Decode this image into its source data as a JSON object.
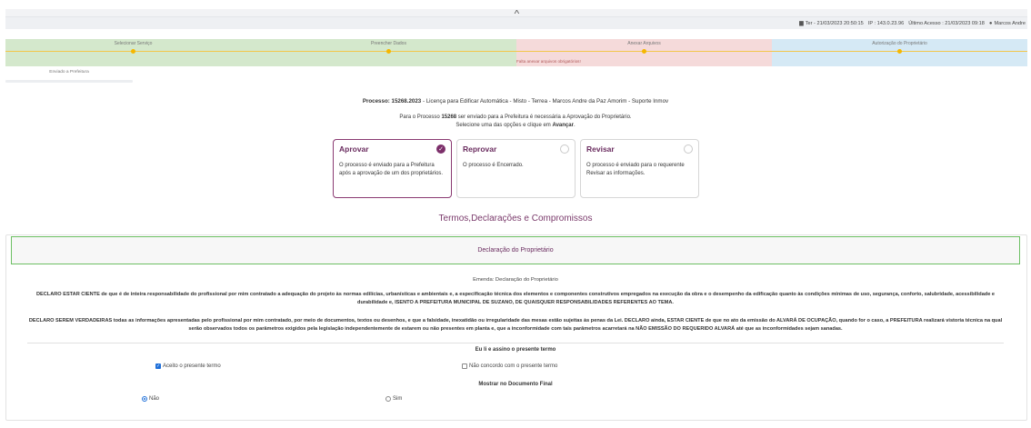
{
  "top": {
    "collapse_glyph": "˄",
    "date_label": "Ter - 21/03/2023 20:50:15",
    "ip_label": "IP : 143.0.23.96",
    "last_access": "Último Acesso : 21/03/2023 09:18",
    "user_name": "Marcos Andre"
  },
  "steps": [
    {
      "label": "Selecionar Serviço",
      "status_color": "#d4e8cc"
    },
    {
      "label": "Preencher Dados",
      "status_color": "#d4e8cc"
    },
    {
      "label": "Anexar Arquivos",
      "status_color": "#f5dada",
      "warning": "Falta anexar arquivos obrigatórios!"
    },
    {
      "label": "Autorização do Proprietário",
      "status_color": "#d5e9f5"
    }
  ],
  "sent_step": {
    "label": "Enviado a Prefeitura"
  },
  "processo": {
    "prefix": "Processo:",
    "number": "15268.2023",
    "description": " - Licença para Edificar Automática - Misto - Terrea - Marcos Andre da Paz Amorim - Suporte Inmov"
  },
  "instructions": {
    "line1_pre": "Para o Processo ",
    "line1_num": "15268",
    "line1_post": " ser enviado para a Prefeitura é necessária a Aprovação do Proprietário.",
    "line2_pre": "Selecione uma das opções e clique em ",
    "line2_bold": "Avançar",
    "line2_post": "."
  },
  "options": [
    {
      "title": "Aprovar",
      "desc": "O processo é enviado para a Prefeitura após a aprovação de um dos proprietários.",
      "selected": true
    },
    {
      "title": "Reprovar",
      "desc": "O processo é Encerrado.",
      "selected": false
    },
    {
      "title": "Revisar",
      "desc": "O processo é enviado para o requerente Revisar as informações.",
      "selected": false
    }
  ],
  "termos_title": "Termos,Declarações e Compromissos",
  "declaracao_header": "Declaração do Proprietário",
  "emenda": "Emenda: Declaração do Proprietário",
  "paragraph1": "DECLARO ESTAR CIENTE de que é de inteira responsabilidade do profissional por mim contratado a adequação do projeto às normas edilícias, urbanísticas e ambientais e, a especificação técnica dos elementos e componentes construtivos empregados na execução da obra e o desempenho da edificação quanto às condições mínimas de uso, segurança, conforto, salubridade, acessibilidade e durabilidade e, ISENTO A PREFEITURA MUNICIPAL DE SUZANO, DE QUAISQUER RESPONSABILIDADES REFERENTES AO TEMA.",
  "paragraph2": "DECLARO SEREM VERDADEIRAS todas as informações apresentadas pelo profissional por mim contratado, por meio de documentos, textos ou desenhos, e que a falsidade, inexatidão ou irregularidade das mesas estão sujeitas às penas da Lei. DECLARO ainda, ESTAR CIENTE de que no ato da emissão do ALVARÁ DE OCUPAÇÃO, quando for o caso, a PREFEITURA realizará vistoria técnica na qual serão observados todos os parâmetros exigidos pela legislação independentemente de estarem ou não presentes em planta e, que a inconformidade com tais parâmetros acarretará na NÃO EMISSÃO DO REQUERIDO ALVARÁ até que as inconformidades sejam sanadas.",
  "assinatura": {
    "title": "Eu li e assino o presente termo",
    "accept_label": "Aceito o presente termo",
    "accept_checked": true,
    "decline_label": "Não concordo com o presente termo",
    "decline_checked": false
  },
  "mostrar": {
    "title": "Mostrar no Documento Final",
    "nao_label": "Não",
    "sim_label": "Sim",
    "selected": "Não"
  }
}
